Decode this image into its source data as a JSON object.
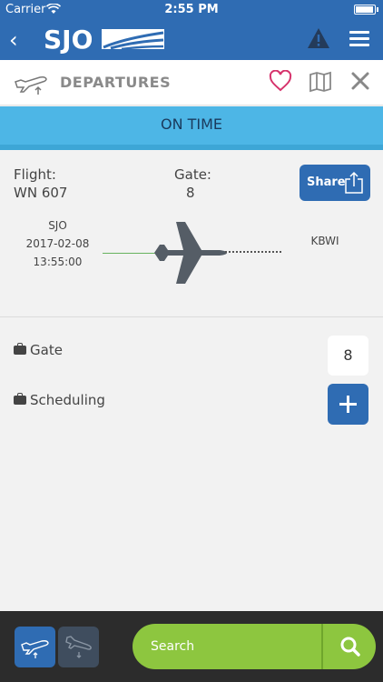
{
  "status_bar": {
    "carrier": "Carrier",
    "time": "2:55 PM"
  },
  "nav": {
    "logo_text": "SJO"
  },
  "header": {
    "title": "DEPARTURES"
  },
  "status": {
    "text": "ON TIME"
  },
  "flight": {
    "flight_label": "Flight:",
    "flight_number": "WN 607",
    "gate_label": "Gate:",
    "gate_number": "8",
    "share_label": "Share"
  },
  "route": {
    "origin_code": "SJO",
    "origin_date": "2017-02-08",
    "origin_time": "13:55:00",
    "destination_code": "KBWI"
  },
  "details": {
    "gate_label": "Gate",
    "gate_value": "8",
    "scheduling_label": "Scheduling"
  },
  "search": {
    "placeholder": "Search"
  },
  "colors": {
    "primary": "#2f6cb3",
    "banner": "#4db6e6",
    "accent_green": "#8dc63f",
    "heart": "#d6336c"
  }
}
